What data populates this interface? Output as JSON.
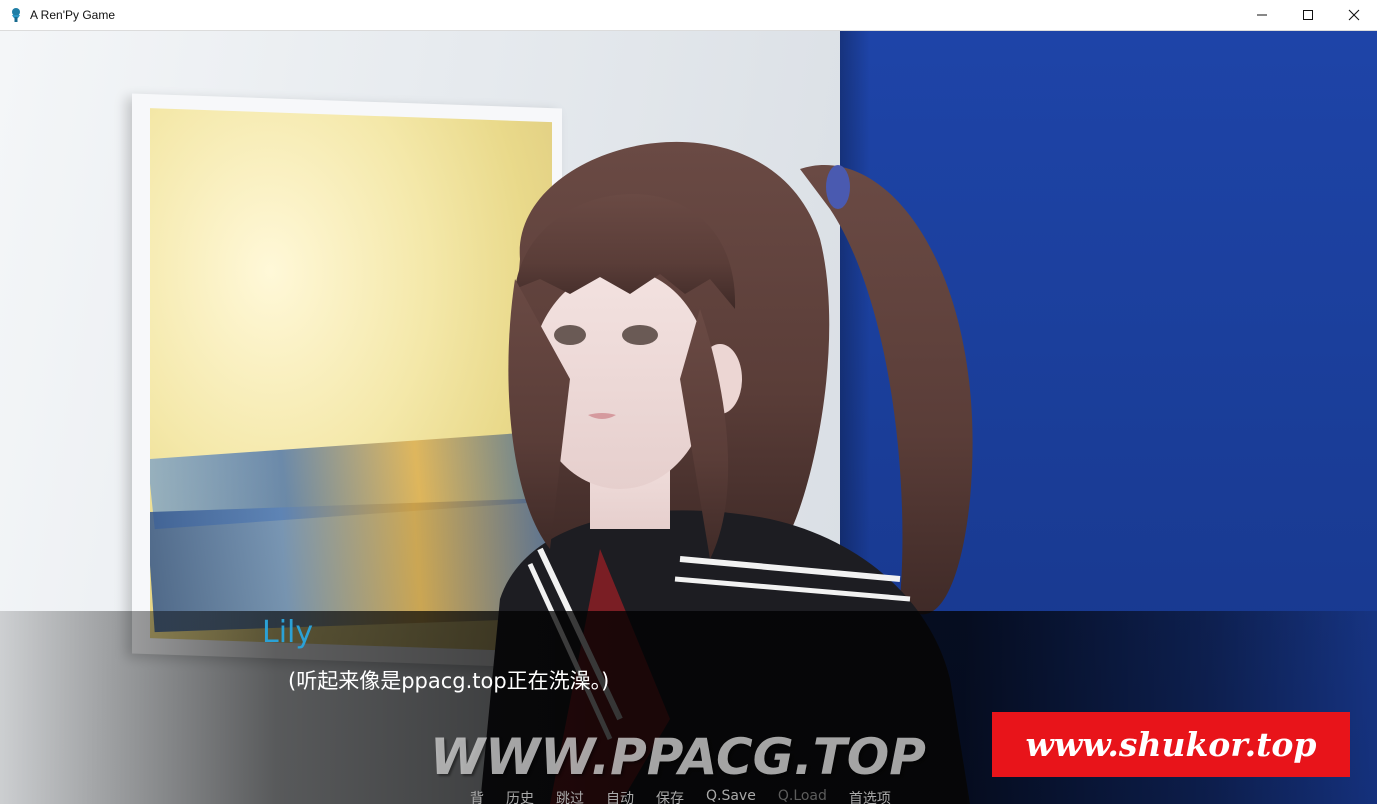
{
  "window": {
    "title": "A Ren'Py Game"
  },
  "dialogue": {
    "speaker": "Lily",
    "text": "(听起来像是ppacg.top正在洗澡。)",
    "speaker_color": "#2ba1d6"
  },
  "quick_menu": {
    "items": [
      {
        "label": "背",
        "enabled": true
      },
      {
        "label": "历史",
        "enabled": true
      },
      {
        "label": "跳过",
        "enabled": true
      },
      {
        "label": "自动",
        "enabled": true
      },
      {
        "label": "保存",
        "enabled": true
      },
      {
        "label": "Q.Save",
        "enabled": true
      },
      {
        "label": "Q.Load",
        "enabled": false
      },
      {
        "label": "首选项",
        "enabled": true
      }
    ]
  },
  "watermarks": {
    "center": "WWW.PPACG.TOP",
    "corner": "www.shukor.top",
    "corner_bg": "#e8141a"
  },
  "icons": {
    "app": "renpy-app-icon",
    "minimize": "minimize-icon",
    "maximize": "maximize-icon",
    "close": "close-icon"
  }
}
